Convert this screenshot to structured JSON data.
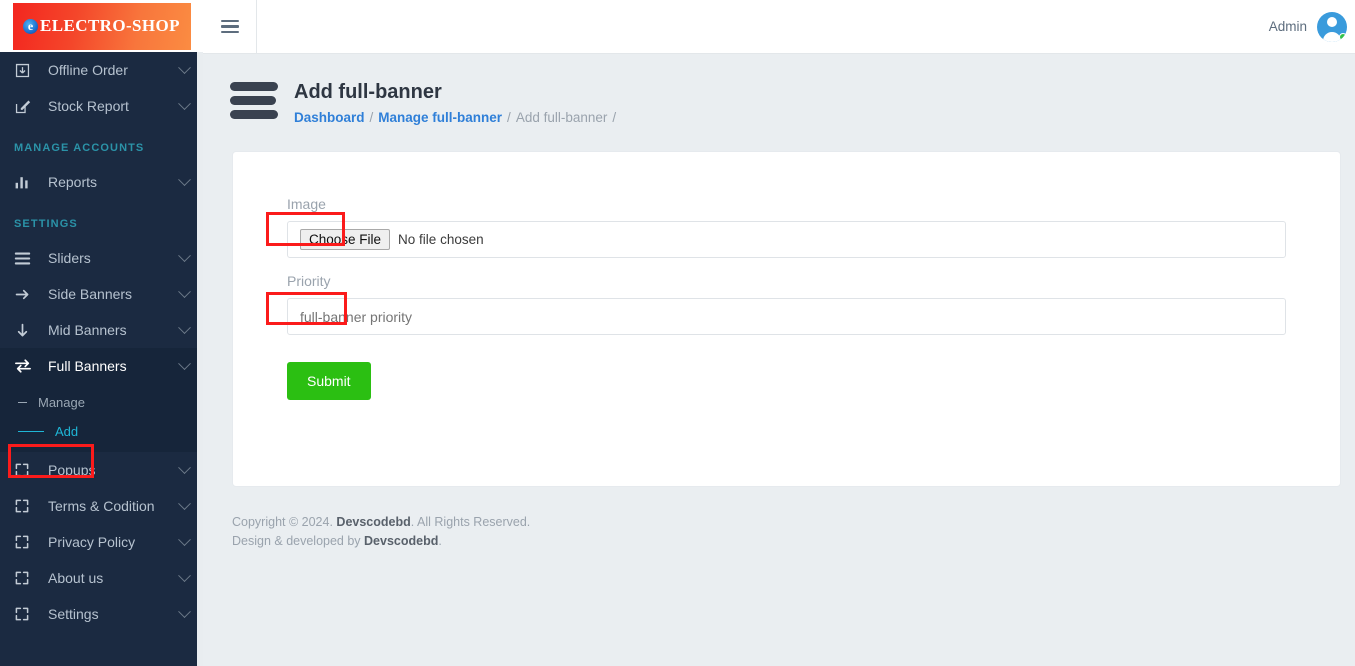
{
  "sidebar": {
    "logo": {
      "mark": "e",
      "text": "ELECTRO-SHOP"
    },
    "items_top": [
      {
        "label": "Offline Order",
        "icon": "download-box-icon"
      },
      {
        "label": "Stock Report",
        "icon": "edit-square-icon"
      }
    ],
    "section_accounts": "MANAGE ACCOUNTS",
    "items_accounts": [
      {
        "label": "Reports",
        "icon": "bar-chart-icon"
      }
    ],
    "section_settings": "SETTINGS",
    "items_settings": [
      {
        "label": "Sliders",
        "icon": "menu-lines-icon"
      },
      {
        "label": "Side Banners",
        "icon": "arrow-right-icon"
      },
      {
        "label": "Mid Banners",
        "icon": "arrow-down-icon"
      },
      {
        "label": "Full Banners",
        "icon": "exchange-arrows-icon"
      }
    ],
    "submenu": [
      {
        "label": "Manage"
      },
      {
        "label": "Add"
      }
    ],
    "items_after": [
      {
        "label": "Popups",
        "icon": "expand-arrows-icon"
      },
      {
        "label": "Terms & Codition",
        "icon": "expand-arrows-icon"
      },
      {
        "label": "Privacy Policy",
        "icon": "expand-arrows-icon"
      },
      {
        "label": "About us",
        "icon": "expand-arrows-icon"
      },
      {
        "label": "Settings",
        "icon": "expand-arrows-icon"
      }
    ]
  },
  "topbar": {
    "menu_toggle_icon": "hamburger-icon",
    "user_name": "Admin",
    "avatar_icon": "user-avatar-icon",
    "status": "online"
  },
  "page": {
    "title": "Add full-banner",
    "breadcrumb": {
      "dashboard": "Dashboard",
      "manage": "Manage full-banner",
      "current": "Add full-banner",
      "separator": "/",
      "trailing": "/"
    }
  },
  "form": {
    "image_label": "Image",
    "file_button": "Choose File",
    "file_status": "No file chosen",
    "priority_label": "Priority",
    "priority_placeholder": "full-banner priority",
    "priority_value": "",
    "submit_label": "Submit"
  },
  "footer": {
    "line1_pre": "Copyright © 2024. ",
    "line1_brand": "Devscodebd",
    "line1_post": ". All Rights Reserved.",
    "line2_pre": "Design & developed by ",
    "line2_brand": "Devscodebd",
    "line2_post": "."
  },
  "colors": {
    "sidebar_bg": "#1b2a41",
    "sidebar_active": "#16253a",
    "accent_teal": "#2b93a8",
    "link_blue": "#2f7fd8",
    "submit_green": "#2bbf12",
    "annotation_red": "#fb1b1b",
    "logo_gradient_from": "#f3261f",
    "logo_gradient_to": "#fb8c42"
  }
}
